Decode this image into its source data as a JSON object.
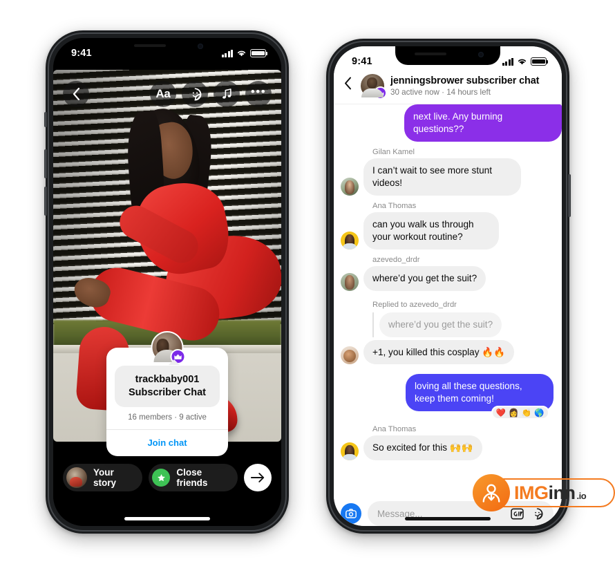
{
  "left_phone": {
    "status_bar": {
      "time": "9:41",
      "signal_icon": "cellular-bars-icon",
      "wifi_icon": "wifi-icon",
      "battery_icon": "battery-icon"
    },
    "story": {
      "back_icon": "chevron-left-icon",
      "tools": [
        {
          "name": "text-tool",
          "label": "Aa",
          "icon": "text-aa-icon"
        },
        {
          "name": "sticker-tool",
          "label": "",
          "icon": "sticker-smiley-icon"
        },
        {
          "name": "music-tool",
          "label": "",
          "icon": "music-note-icon"
        },
        {
          "name": "more-tool",
          "label": "•••",
          "icon": "more-dots-icon"
        }
      ],
      "subscriber_card": {
        "avatar_icon": "creator-avatar",
        "badge_icon": "crown-badge-icon",
        "username": "trackbaby001",
        "chat_label": "Subscriber Chat",
        "meta": "16 members · 9 active",
        "cta": "Join chat",
        "cta_color": "#0095f6"
      },
      "bottom_bar": {
        "your_story_label": "Your story",
        "your_story_avatar": "your-story-avatar",
        "close_friends_label": "Close friends",
        "close_friends_icon": "green-star-icon",
        "close_friends_color": "#3ec255",
        "send_icon": "arrow-right-icon"
      }
    }
  },
  "right_phone": {
    "status_bar": {
      "time": "9:41",
      "signal_icon": "cellular-bars-icon",
      "wifi_icon": "wifi-icon",
      "battery_icon": "battery-icon"
    },
    "header": {
      "back_icon": "chevron-left-icon",
      "avatar_icon": "creator-avatar",
      "badge_icon": "crown-badge-icon",
      "title": "jenningsbrower subscriber chat",
      "subtitle": "30 active now · 14 hours left"
    },
    "colors": {
      "outgoing_purple": "#8b2fe8",
      "outgoing_blue": "#4b44f5",
      "incoming_grey": "#efefef"
    },
    "messages": [
      {
        "id": "m0",
        "direction": "out",
        "text": "next live. Any burning questions??",
        "bubble_color": "#8b2fe8",
        "clipped_top": true
      },
      {
        "id": "m1",
        "direction": "in",
        "sender": "Gilan Kamel",
        "text": "I can’t wait to see more stunt videos!",
        "avatar": "gilan-kamel-avatar"
      },
      {
        "id": "m2",
        "direction": "in",
        "sender": "Ana Thomas",
        "text": "can you walk us through your workout routine?",
        "avatar": "ana-thomas-avatar"
      },
      {
        "id": "m3",
        "direction": "in",
        "sender": "azevedo_drdr",
        "text": "where’d you get the suit?",
        "avatar": "azevedo-drdr-avatar"
      },
      {
        "id": "m4",
        "direction": "in",
        "reply_label": "Replied to azevedo_drdr",
        "quoted_text": "where’d you get the suit?",
        "text": "+1, you killed this cosplay 🔥🔥",
        "avatar": "replier-avatar"
      },
      {
        "id": "m5",
        "direction": "out",
        "text": "loving all these questions, keep them coming!",
        "bubble_color": "#4b44f5",
        "reactions": "❤️ 👩 👏 🌎"
      },
      {
        "id": "m6",
        "direction": "in",
        "sender": "Ana Thomas",
        "text": "So excited for this 🙌🙌",
        "avatar": "ana-thomas-avatar"
      }
    ],
    "composer": {
      "camera_icon": "camera-icon",
      "camera_color": "#1778f2",
      "placeholder": "Message...",
      "gif_icon": "gif-icon",
      "sticker_icon": "sticker-smiley-icon"
    }
  },
  "watermark": {
    "badge_icon": "download-person-icon",
    "part_im": "IM",
    "part_g": "G",
    "part_inn": "inn",
    "part_io": ".io",
    "color": "#f47b20"
  }
}
